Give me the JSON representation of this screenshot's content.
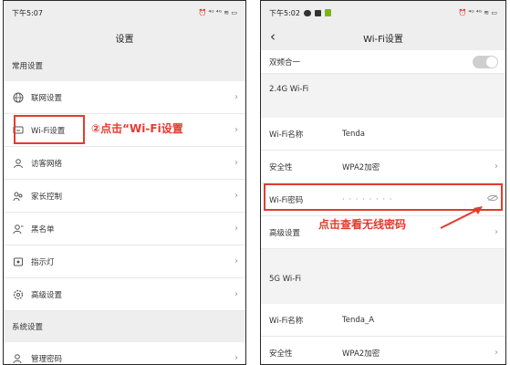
{
  "left": {
    "status": {
      "time": "下午5:07",
      "icons": "⏰ ⁴ᴳ ⁴ᴳ ≋ ▭"
    },
    "title": "设置",
    "sections": [
      {
        "header": "常用设置",
        "items": [
          {
            "label": "联网设置",
            "icon": "globe-icon"
          },
          {
            "label": "Wi-Fi设置",
            "icon": "wifi-settings-icon",
            "highlight": true
          },
          {
            "label": "访客网络",
            "icon": "guest-network-icon"
          },
          {
            "label": "家长控制",
            "icon": "parental-control-icon"
          },
          {
            "label": "黑名单",
            "icon": "blacklist-icon"
          },
          {
            "label": "指示灯",
            "icon": "indicator-light-icon"
          },
          {
            "label": "高级设置",
            "icon": "advanced-settings-icon"
          }
        ]
      },
      {
        "header": "系统设置",
        "items": [
          {
            "label": "管理密码",
            "icon": "admin-password-icon"
          }
        ]
      }
    ],
    "annotation": "②点击“Wi-Fi设置"
  },
  "right": {
    "status": {
      "time": "下午5:02",
      "icons": "⏰ ⁴ᴳ ⁴ᴳ ≋ ▭"
    },
    "title": "Wi-Fi设置",
    "dual_band": {
      "label": "双频合一",
      "enabled": false
    },
    "band24": {
      "header": "2.4G Wi-Fi",
      "name_label": "Wi-Fi名称",
      "name_value": "Tenda",
      "security_label": "安全性",
      "security_value": "WPA2加密",
      "password_label": "Wi-Fi密码",
      "password_value": "· · · · · · · ·",
      "advanced_label": "高级设置"
    },
    "band5": {
      "header": "5G Wi-Fi",
      "name_label": "Wi-Fi名称",
      "name_value": "Tenda_A",
      "security_label": "安全性",
      "security_value": "WPA2加密"
    },
    "annotation": "点击查看无线密码"
  },
  "colors": {
    "accent": "#e23b2e",
    "bar": "#eeeeee"
  }
}
